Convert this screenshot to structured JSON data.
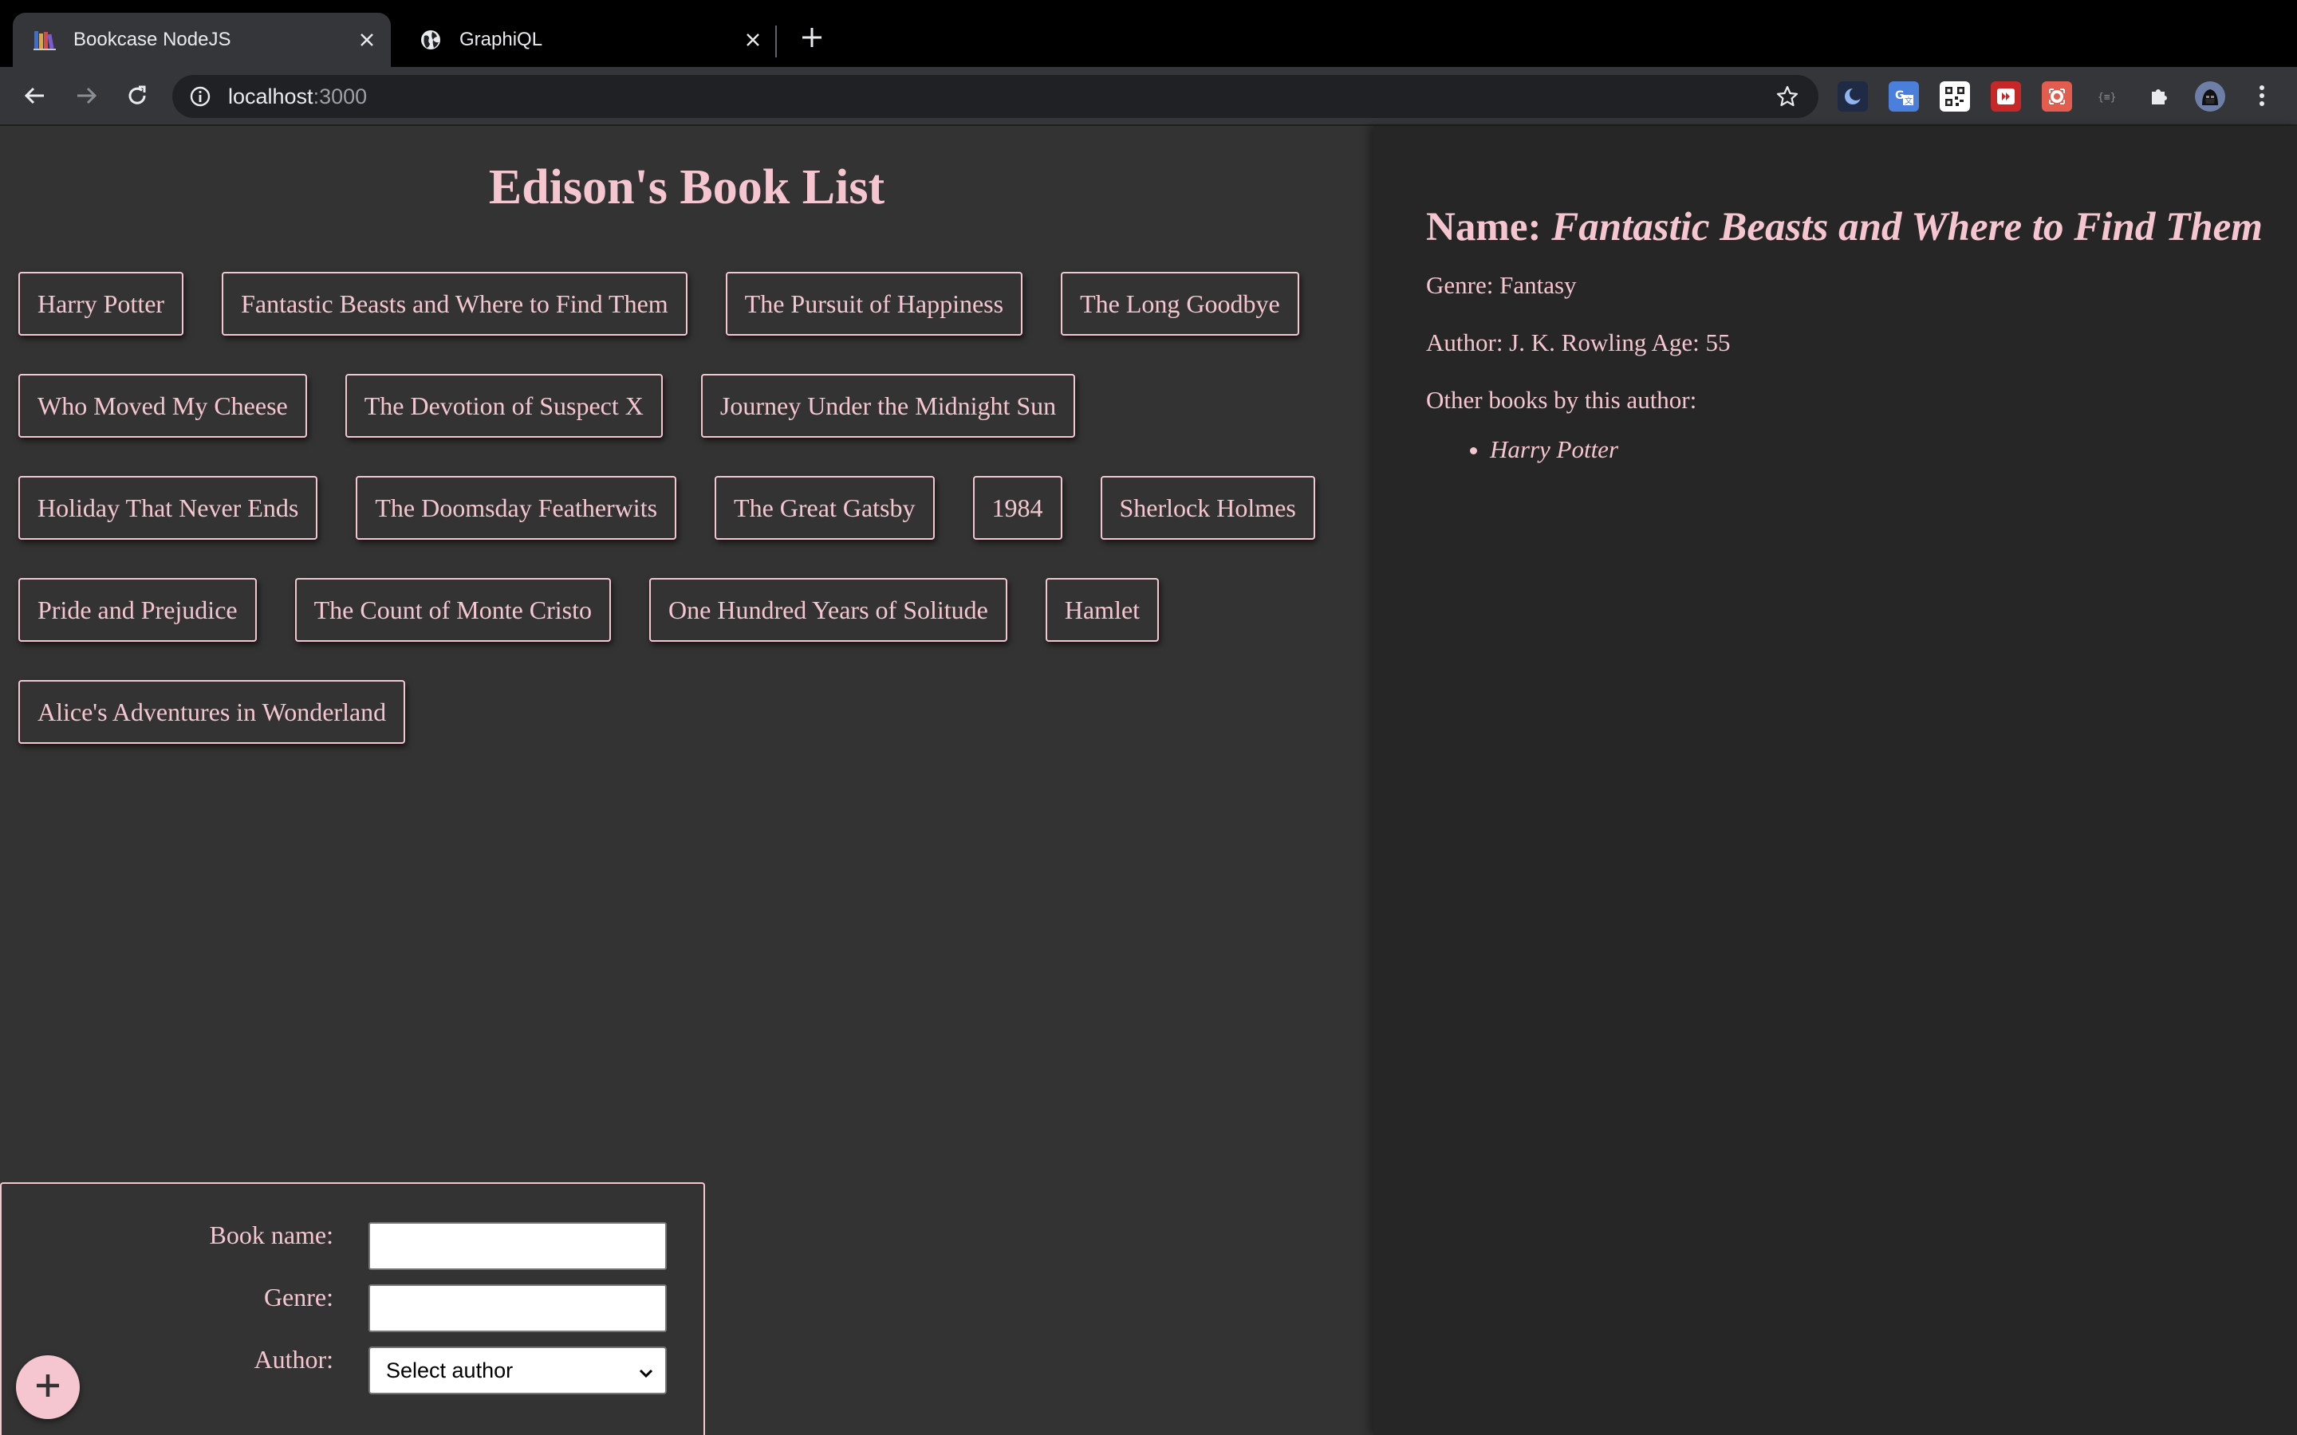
{
  "browser": {
    "tabs": [
      {
        "title": "Bookcase NodeJS",
        "active": true
      },
      {
        "title": "GraphiQL",
        "active": false
      }
    ],
    "address": {
      "host": "localhost",
      "port": ":3000"
    },
    "extensions": [
      "moon-extension-icon",
      "translate-extension-icon",
      "qr-code-extension-icon",
      "media-extension-icon",
      "screenshot-extension-icon",
      "json-extension-icon",
      "puzzle-icon",
      "profile-avatar"
    ]
  },
  "page": {
    "title": "Edison's Book List",
    "books": [
      "Harry Potter",
      "Fantastic Beasts and Where to Find Them",
      "The Pursuit of Happiness",
      "The Long Goodbye",
      "Who Moved My Cheese",
      "The Devotion of Suspect X",
      "Journey Under the Midnight Sun",
      "Holiday That Never Ends",
      "The Doomsday Featherwits",
      "The Great Gatsby",
      "1984",
      "Sherlock Holmes",
      "Pride and Prejudice",
      "The Count of Monte Cristo",
      "One Hundred Years of Solitude",
      "Hamlet",
      "Alice's Adventures in Wonderland"
    ]
  },
  "details": {
    "name_label": "Name: ",
    "name": "Fantastic Beasts and Where to Find Them",
    "genre": "Genre: Fantasy",
    "author": "Author: J. K. Rowling Age: 55",
    "other_books_label": "Other books by this author:",
    "other_books": [
      "Harry Potter"
    ]
  },
  "form": {
    "book_name_label": "Book name:",
    "genre_label": "Genre:",
    "author_label": "Author:",
    "author_select_value": "Select author"
  },
  "colors": {
    "accent": "#f5c6d0",
    "main_bg": "#333333",
    "side_bg": "#262626"
  }
}
